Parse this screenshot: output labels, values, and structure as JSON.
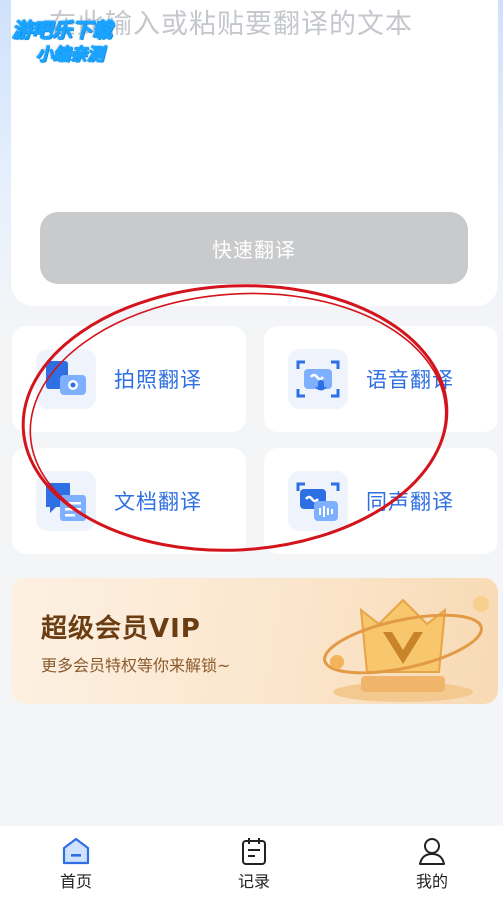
{
  "input": {
    "placeholder": "在此输入或粘贴要翻译的文本"
  },
  "watermark": {
    "line1": "游吧乐下载",
    "line2": "小编亲测"
  },
  "quick_translate": {
    "label": "快速翻译"
  },
  "features": [
    {
      "label": "拍照翻译",
      "icon": "photo-translate-icon"
    },
    {
      "label": "语音翻译",
      "icon": "voice-translate-icon"
    },
    {
      "label": "文档翻译",
      "icon": "document-translate-icon"
    },
    {
      "label": "同声翻译",
      "icon": "simultaneous-translate-icon"
    }
  ],
  "vip": {
    "title": "超级会员VIP",
    "subtitle": "更多会员特权等你来解锁~",
    "icon": "vip-crown-badge"
  },
  "tabbar": [
    {
      "label": "首页",
      "icon": "home-icon",
      "active": true
    },
    {
      "label": "记录",
      "icon": "record-icon",
      "active": false
    },
    {
      "label": "我的",
      "icon": "profile-icon",
      "active": false
    }
  ],
  "colors": {
    "accent": "#2f6fe4",
    "button_disabled": "#c9cacc",
    "annotation": "#d4141c",
    "vip_text": "#6a3d12"
  }
}
